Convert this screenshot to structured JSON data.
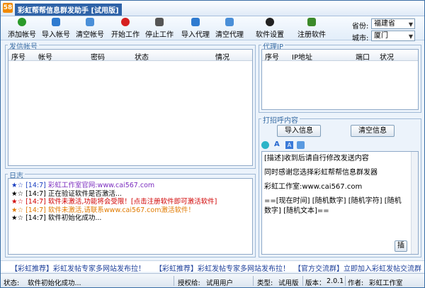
{
  "window": {
    "title": "彩虹帮帮信息群发助手 [试用版]",
    "logo": "58"
  },
  "toolbar": {
    "buttons": [
      {
        "label": "添加帐号",
        "icon": "add-icon",
        "color": "#2a9a2a"
      },
      {
        "label": "导入帐号",
        "icon": "import-icon",
        "color": "#2f7bd0"
      },
      {
        "label": "清空帐号",
        "icon": "clear-icon",
        "color": "#4a8fd8"
      },
      {
        "label": "开始工作",
        "icon": "play-icon",
        "color": "#d62020"
      },
      {
        "label": "停止工作",
        "icon": "stop-icon",
        "color": "#555555"
      },
      {
        "label": "导入代理",
        "icon": "import-proxy-icon",
        "color": "#2f7bd0"
      },
      {
        "label": "清空代理",
        "icon": "clear-proxy-icon",
        "color": "#4a8fd8"
      },
      {
        "label": "软件设置",
        "icon": "info-icon",
        "color": "#222222"
      },
      {
        "label": "注册软件",
        "icon": "key-icon",
        "color": "#3b8a2a"
      }
    ],
    "province_label": "省份:",
    "province_value": "福建省",
    "city_label": "城市:",
    "city_value": "厦门"
  },
  "accounts": {
    "title": "发信帐号",
    "columns": [
      "序号",
      "帐号",
      "密码",
      "状态",
      "情况"
    ]
  },
  "proxy": {
    "title": "代理IP",
    "columns": [
      "序号",
      "IP地址",
      "端口",
      "状况"
    ]
  },
  "greeting": {
    "title": "打招呼内容",
    "import_btn": "导入信息",
    "clear_btn": "清空信息",
    "lines": [
      "[描述]收到后请自行修改发送内容",
      "同时感谢您选择彩虹帮帮信息群发器",
      "彩虹工作室:www.cai567.com",
      "==[现在时间] [随机数字] [随机字符] [随机数字] [随机文本]=="
    ],
    "side_btn": "插"
  },
  "log": {
    "title": "日志",
    "lines": [
      {
        "time": "[14:7]",
        "text": "彩虹工作室官网:www.cai567.com",
        "color": "#7b2cbf"
      },
      {
        "time": "[14:7]",
        "text": "正在验证软件是否激活...",
        "color": "#000000"
      },
      {
        "time": "[14:7]",
        "text": "软件未激活,功能将会受限！[点击注册软件即可激活软件]",
        "color": "#d00000"
      },
      {
        "time": "[14:7]",
        "text": "软件未激活,请联系www.cai567.com激活软件！",
        "color": "#e07a00"
      },
      {
        "time": "[14:7]",
        "text": "软件初始化成功...",
        "color": "#000000"
      }
    ]
  },
  "links": [
    "【彩虹推荐】彩虹发帖专家多网站发布拉！",
    "【彩虹推荐】彩虹发帖专家多网站发布拉！",
    "【官方交流群】立即加入彩虹发帖交流群@"
  ],
  "status": {
    "state_label": "状态:",
    "state_value": "软件初始化成功...",
    "auth_label": "授权给:",
    "auth_value": "试用用户",
    "type_label": "类型:",
    "type_value": "试用版",
    "version_label": "版本：",
    "version_value": "2.0.1",
    "author_label": "作者:",
    "author_value": "彩虹工作室"
  }
}
